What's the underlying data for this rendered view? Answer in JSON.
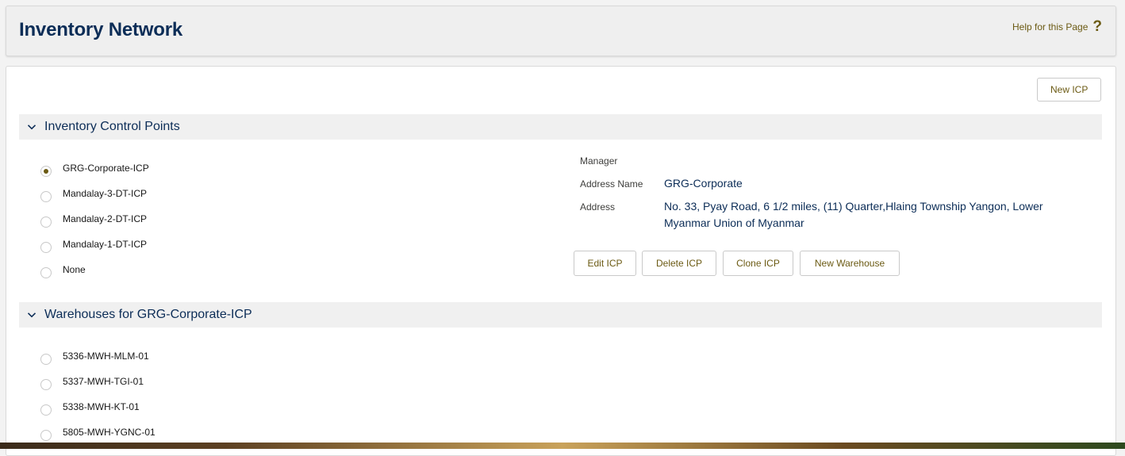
{
  "header": {
    "title": "Inventory Network",
    "help_label": "Help for this Page",
    "help_icon": "question-mark-icon"
  },
  "actions": {
    "new_icp": "New ICP"
  },
  "icp_section": {
    "title": "Inventory Control Points",
    "items": [
      {
        "label": "GRG-Corporate-ICP",
        "selected": true
      },
      {
        "label": "Mandalay-3-DT-ICP",
        "selected": false
      },
      {
        "label": "Mandalay-2-DT-ICP",
        "selected": false
      },
      {
        "label": "Mandalay-1-DT-ICP",
        "selected": false
      },
      {
        "label": "None",
        "selected": false
      }
    ]
  },
  "details": {
    "manager_label": "Manager",
    "manager_value": "",
    "address_name_label": "Address Name",
    "address_name_value": "GRG-Corporate",
    "address_label": "Address",
    "address_value": "No. 33, Pyay Road, 6 1/2 miles, (11) Quarter,Hlaing Township Yangon, Lower Myanmar Union of Myanmar"
  },
  "icp_buttons": {
    "edit": "Edit ICP",
    "delete": "Delete ICP",
    "clone": "Clone ICP",
    "new_warehouse": "New Warehouse"
  },
  "warehouse_section": {
    "title": "Warehouses for GRG-Corporate-ICP",
    "items": [
      {
        "label": "5336-MWH-MLM-01",
        "selected": false
      },
      {
        "label": "5337-MWH-TGI-01",
        "selected": false
      },
      {
        "label": "5338-MWH-KT-01",
        "selected": false
      },
      {
        "label": "5805-MWH-YGNC-01",
        "selected": false
      }
    ]
  },
  "colors": {
    "title": "#0c2d57",
    "accent": "#6b5a13",
    "section_bg": "#f0f0f0"
  }
}
